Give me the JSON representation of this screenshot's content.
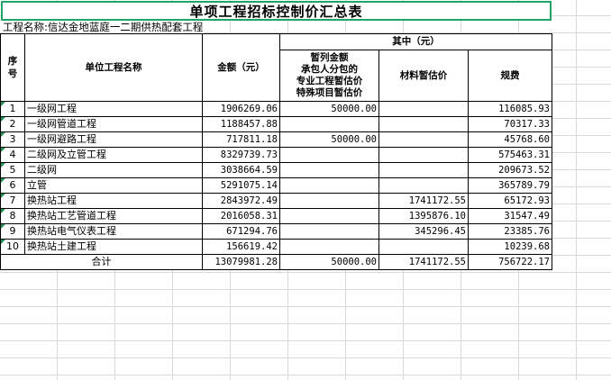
{
  "title": "单项工程招标控制价汇总表",
  "project_label": "工程名称:信达金地蓝庭一二期供热配套工程",
  "headers": {
    "seq": "序号",
    "unit_name": "单位工程名称",
    "amount": "金额（元）",
    "of_which": "其中（元）",
    "provisional": "暂列金额\n承包人分包的\n专业工程暂估价\n特殊项目暂估价",
    "material": "材料暂估价",
    "fee": "规费"
  },
  "rows": [
    {
      "seq": "1",
      "name": "一级网工程",
      "amount": "1906269.06",
      "provisional": "50000.00",
      "material": "",
      "fee": "116085.93"
    },
    {
      "seq": "2",
      "name": "一级网管道工程",
      "amount": "1188457.88",
      "provisional": "",
      "material": "",
      "fee": "70317.33"
    },
    {
      "seq": "3",
      "name": "一级网避路工程",
      "amount": "717811.18",
      "provisional": "50000.00",
      "material": "",
      "fee": "45768.60"
    },
    {
      "seq": "4",
      "name": "二级网及立管工程",
      "amount": "8329739.73",
      "provisional": "",
      "material": "",
      "fee": "575463.31"
    },
    {
      "seq": "5",
      "name": "二级网",
      "amount": "3038664.59",
      "provisional": "",
      "material": "",
      "fee": "209673.52"
    },
    {
      "seq": "6",
      "name": "立管",
      "amount": "5291075.14",
      "provisional": "",
      "material": "",
      "fee": "365789.79"
    },
    {
      "seq": "7",
      "name": "换热站工程",
      "amount": "2843972.49",
      "provisional": "",
      "material": "1741172.55",
      "fee": "65172.93"
    },
    {
      "seq": "8",
      "name": "换热站工艺管道工程",
      "amount": "2016058.31",
      "provisional": "",
      "material": "1395876.10",
      "fee": "31547.49"
    },
    {
      "seq": "9",
      "name": "换热站电气仪表工程",
      "amount": "671294.76",
      "provisional": "",
      "material": "345296.45",
      "fee": "23385.76"
    },
    {
      "seq": "10",
      "name": "换热站土建工程",
      "amount": "156619.42",
      "provisional": "",
      "material": "",
      "fee": "10239.68"
    }
  ],
  "total": {
    "label": "合计",
    "amount": "13079981.28",
    "provisional": "50000.00",
    "material": "1741172.55",
    "fee": "756722.17"
  },
  "colors": {
    "selection_border": "#21a366",
    "gridline": "#d9d9d9",
    "cell_marker": "#1e8f4e"
  }
}
